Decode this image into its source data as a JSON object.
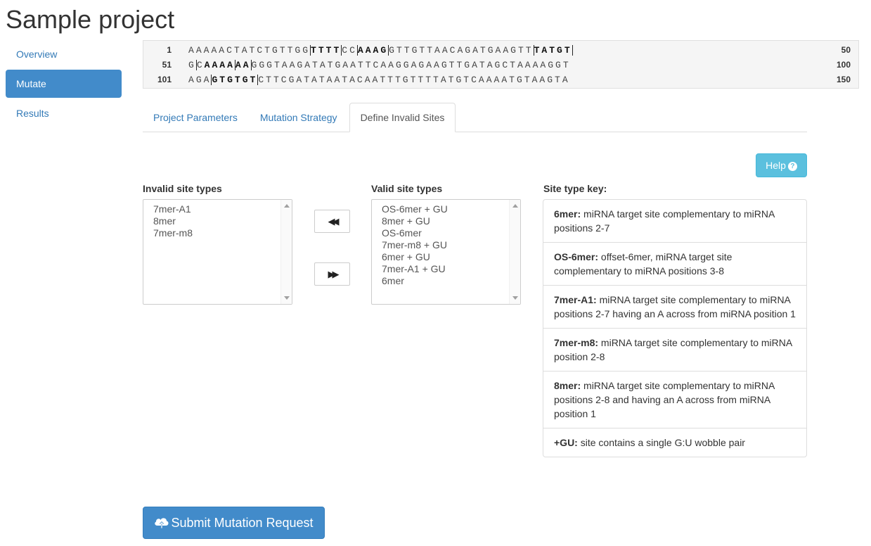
{
  "page": {
    "title": "Sample project"
  },
  "sidebar": {
    "items": [
      {
        "label": "Overview",
        "active": false
      },
      {
        "label": "Mutate",
        "active": true
      },
      {
        "label": "Results",
        "active": false
      }
    ]
  },
  "sequence": {
    "rows": [
      {
        "start": "1",
        "end": "50",
        "seq": "AAAAACTATCTGTTGGTTTTCCAAAGGTTGTTAACAGATGAAGTTTATGT"
      },
      {
        "start": "51",
        "end": "100",
        "seq": "GCAAAAAAGGGTAAGATATGAATTCAAGGAGAAGTTGATAGCTAAAAGGT"
      },
      {
        "start": "101",
        "end": "150",
        "seq": "AGAGTGTGTCTTCGATATAATACAATTTGTTTTATGTCAAAATGTAAGTA"
      }
    ]
  },
  "tabs": [
    {
      "label": "Project Parameters",
      "active": false
    },
    {
      "label": "Mutation Strategy",
      "active": false
    },
    {
      "label": "Define Invalid Sites",
      "active": true
    }
  ],
  "help": {
    "label": "Help",
    "icon": "question-circle-icon"
  },
  "invalid": {
    "label": "Invalid site types",
    "options": [
      "7mer-A1",
      "8mer",
      "7mer-m8"
    ]
  },
  "valid": {
    "label": "Valid site types",
    "options": [
      "OS-6mer + GU",
      "8mer + GU",
      "OS-6mer",
      "7mer-m8 + GU",
      "6mer + GU",
      "7mer-A1 + GU",
      "6mer"
    ]
  },
  "move_buttons": {
    "to_invalid_glyph": "◀◀",
    "to_valid_glyph": "▶▶"
  },
  "key": {
    "label": "Site type key:",
    "items": [
      {
        "term": "6mer:",
        "desc": "miRNA target site complementary to miRNA positions 2-7"
      },
      {
        "term": "OS-6mer:",
        "desc": "offset-6mer, miRNA target site complementary to miRNA positions 3-8"
      },
      {
        "term": "7mer-A1:",
        "desc": "miRNA target site complementary to miRNA positions 2-7 having an A across from miRNA position 1"
      },
      {
        "term": "7mer-m8:",
        "desc": "miRNA target site complementary to miRNA position 2-8"
      },
      {
        "term": "8mer:",
        "desc": "miRNA target site complementary to miRNA positions 2-8 and having an A across from miRNA position 1"
      },
      {
        "term": "+GU:",
        "desc": "site contains a single G:U wobble pair"
      }
    ]
  },
  "submit": {
    "label": "Submit Mutation Request",
    "icon": "cloud-upload-icon"
  },
  "colors": {
    "primary": "#428bca",
    "info": "#5bc0de",
    "link": "#337ab7"
  }
}
